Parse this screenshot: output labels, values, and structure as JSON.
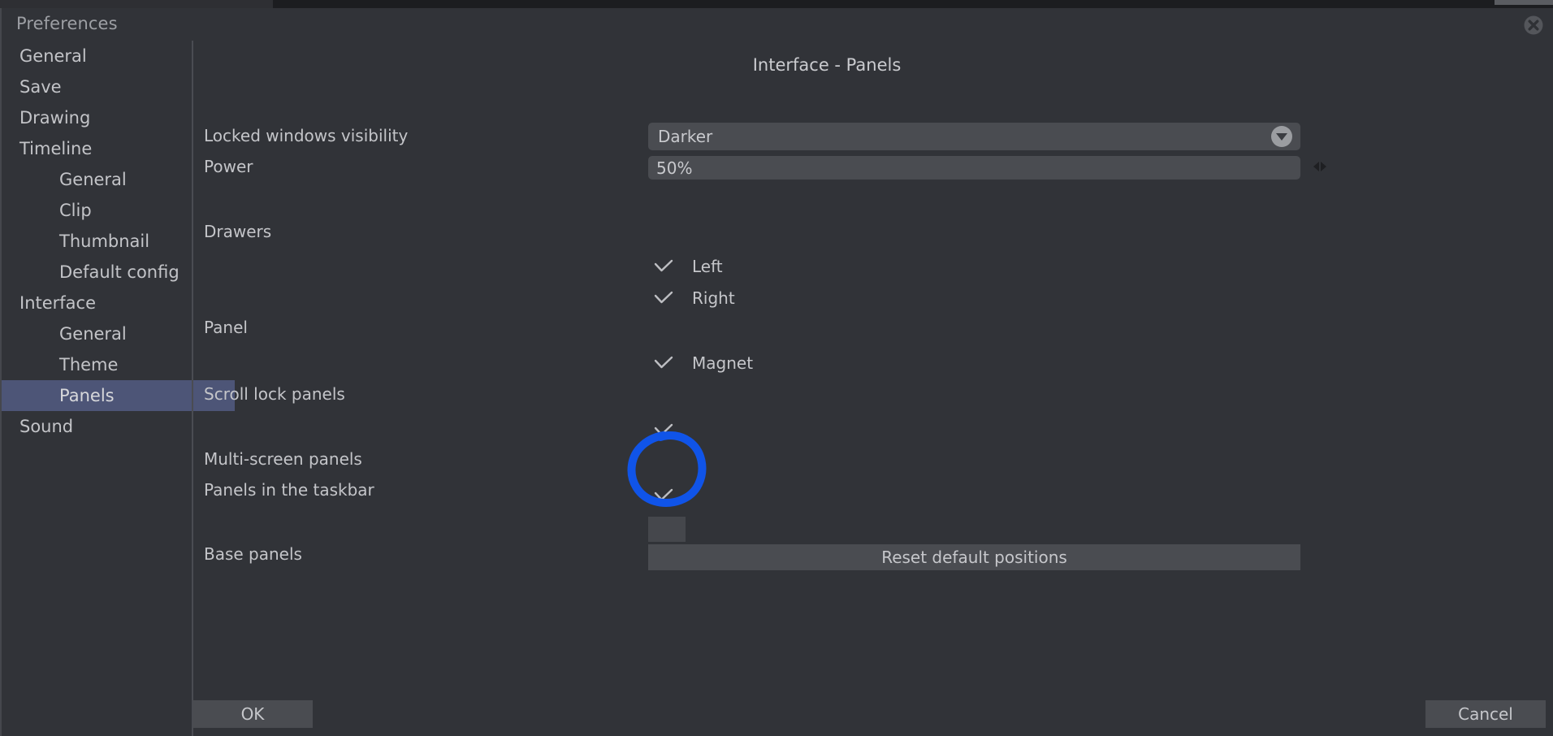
{
  "window": {
    "title": "Preferences",
    "close_icon": "close-circle-icon"
  },
  "sidebar": {
    "items": [
      {
        "label": "General",
        "level": 0,
        "selected": false
      },
      {
        "label": "Save",
        "level": 0,
        "selected": false
      },
      {
        "label": "Drawing",
        "level": 0,
        "selected": false
      },
      {
        "label": "Timeline",
        "level": 0,
        "selected": false
      },
      {
        "label": "General",
        "level": 1,
        "selected": false
      },
      {
        "label": "Clip",
        "level": 1,
        "selected": false
      },
      {
        "label": "Thumbnail",
        "level": 1,
        "selected": false
      },
      {
        "label": "Default config",
        "level": 1,
        "selected": false
      },
      {
        "label": "Interface",
        "level": 0,
        "selected": false
      },
      {
        "label": "General",
        "level": 1,
        "selected": false
      },
      {
        "label": "Theme",
        "level": 1,
        "selected": false
      },
      {
        "label": "Panels",
        "level": 1,
        "selected": true
      },
      {
        "label": "Sound",
        "level": 0,
        "selected": false
      }
    ],
    "selected_highlight_color": "#4d5577"
  },
  "main": {
    "heading": "Interface - Panels",
    "rows": {
      "locked_windows_visibility": {
        "label": "Locked windows visibility",
        "value": "Darker",
        "dropdown_icon": "chevron-down-circle-icon"
      },
      "power": {
        "label": "Power",
        "value": "50%",
        "spinner_icons": "left-right-arrows-icon"
      },
      "drawers": {
        "label": "Drawers",
        "options": [
          {
            "label": "Left",
            "checked": true,
            "check_icon": "checkmark-icon"
          },
          {
            "label": "Right",
            "checked": true,
            "check_icon": "checkmark-icon"
          }
        ]
      },
      "panel": {
        "label": "Panel",
        "options": [
          {
            "label": "Magnet",
            "checked": true,
            "check_icon": "checkmark-icon"
          }
        ]
      },
      "scroll_lock_panels": {
        "label": "Scroll lock panels",
        "checked": true,
        "check_icon": "checkmark-icon"
      },
      "multi_screen_panels": {
        "label": "Multi-screen panels",
        "checked": true,
        "check_icon": "checkmark-icon",
        "annotated": true
      },
      "panels_in_taskbar": {
        "label": "Panels in the taskbar",
        "checked": false
      },
      "base_panels": {
        "label": "Base panels",
        "button_label": "Reset default positions"
      }
    }
  },
  "footer": {
    "ok_label": "OK",
    "cancel_label": "Cancel"
  },
  "annotation": {
    "type": "hand-drawn-circle",
    "color": "#1054e8",
    "target": "multi-screen-panels-checkmark"
  }
}
